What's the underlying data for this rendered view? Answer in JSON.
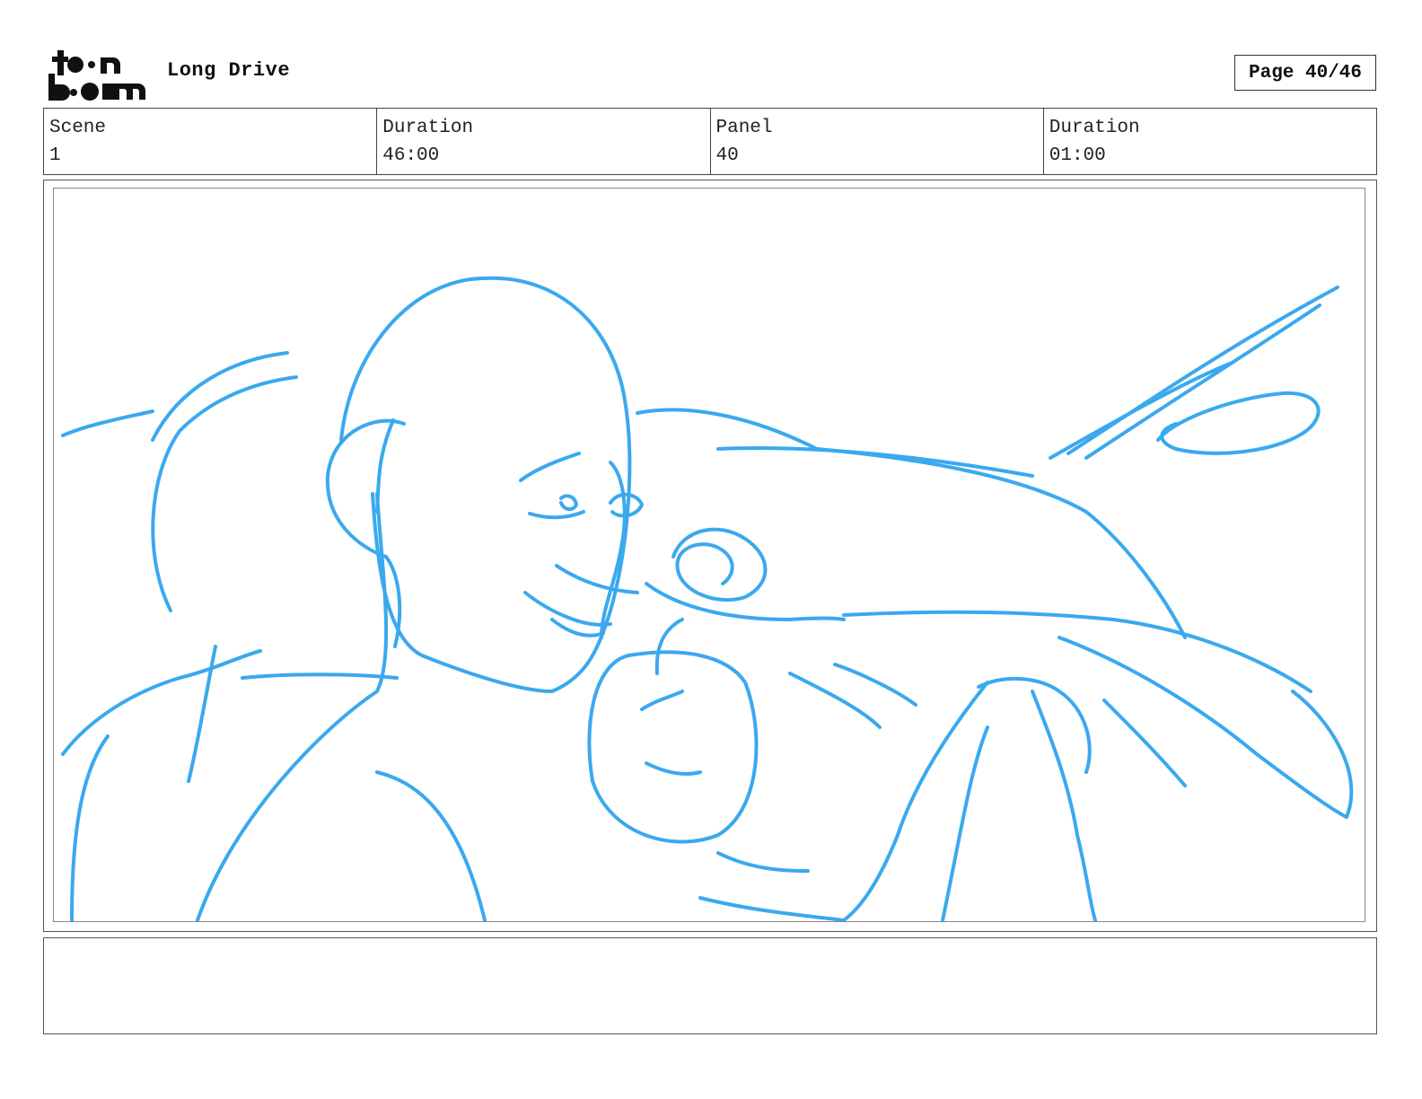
{
  "header": {
    "logo_text": "toon boom",
    "project_title": "Long Drive",
    "page_label": "Page 40/46"
  },
  "info": [
    {
      "label": "Scene",
      "value": "1"
    },
    {
      "label": "Duration",
      "value": "46:00"
    },
    {
      "label": "Panel",
      "value": "40"
    },
    {
      "label": "Duration",
      "value": "01:00"
    }
  ],
  "panel": {
    "sketch_color": "#3aa9ee",
    "description": ""
  },
  "notes": {
    "text": ""
  }
}
